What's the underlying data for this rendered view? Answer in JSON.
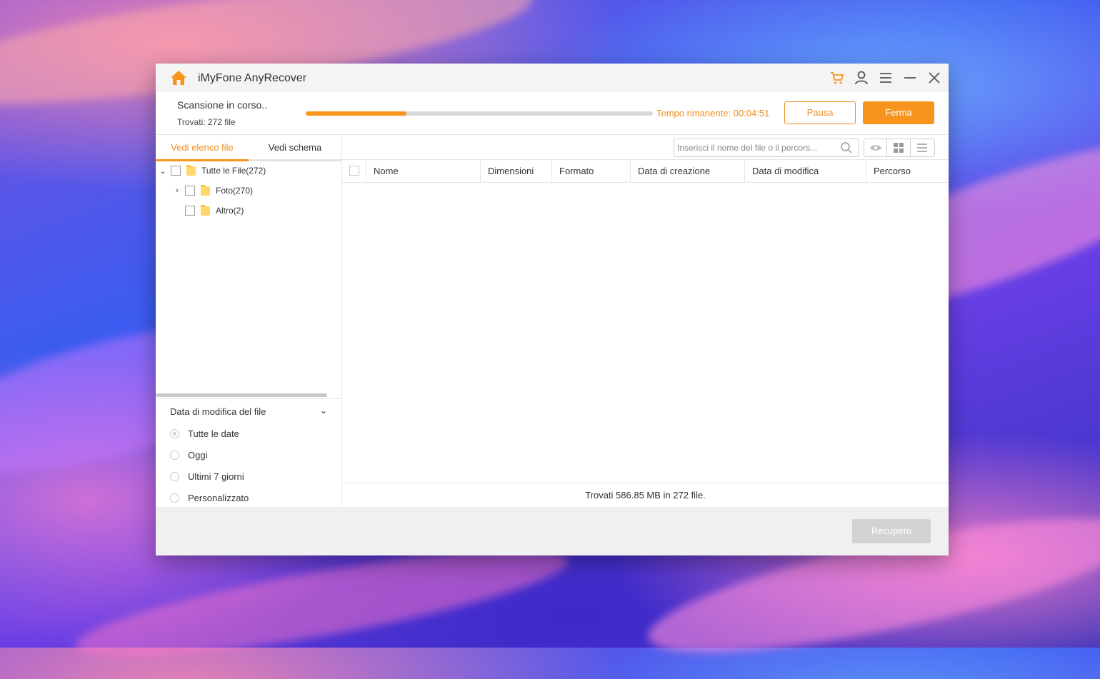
{
  "app": {
    "title": "iMyFone AnyRecover",
    "accent_color": "#f7941d",
    "title_icons": [
      "home-icon",
      "cart-icon",
      "user-icon",
      "menu-icon",
      "minimize-icon",
      "close-icon"
    ]
  },
  "scan": {
    "status": "Scansione in corso..",
    "found": "Trovati: 272 file",
    "progress_fraction": 0.29,
    "time_left": "Tempo rimanente: 00:04:51",
    "pause_label": "Pausa",
    "stop_label": "Ferma"
  },
  "tabs": {
    "file_list": "Vedi elenco file",
    "schema": "Vedi schema"
  },
  "tree": {
    "items": [
      {
        "label": "Tutte le File(272)"
      },
      {
        "label": "Foto(270)"
      },
      {
        "label": "Altro(2)"
      }
    ]
  },
  "filter": {
    "title": "Data di modifica del file",
    "options": [
      "Tutte le date",
      "Oggi",
      "Ultimi 7 giorni",
      "Personalizzato"
    ],
    "selected": "Tutte le date"
  },
  "search": {
    "placeholder": "Inserisci il nome del file o il percors..."
  },
  "table": {
    "columns": [
      "Nome",
      "Dimensioni",
      "Formato",
      "Data di creazione",
      "Data di modifica",
      "Percorso"
    ]
  },
  "summary": "Trovati 586.85 MB in 272 file.",
  "recover_label": "Recupero"
}
